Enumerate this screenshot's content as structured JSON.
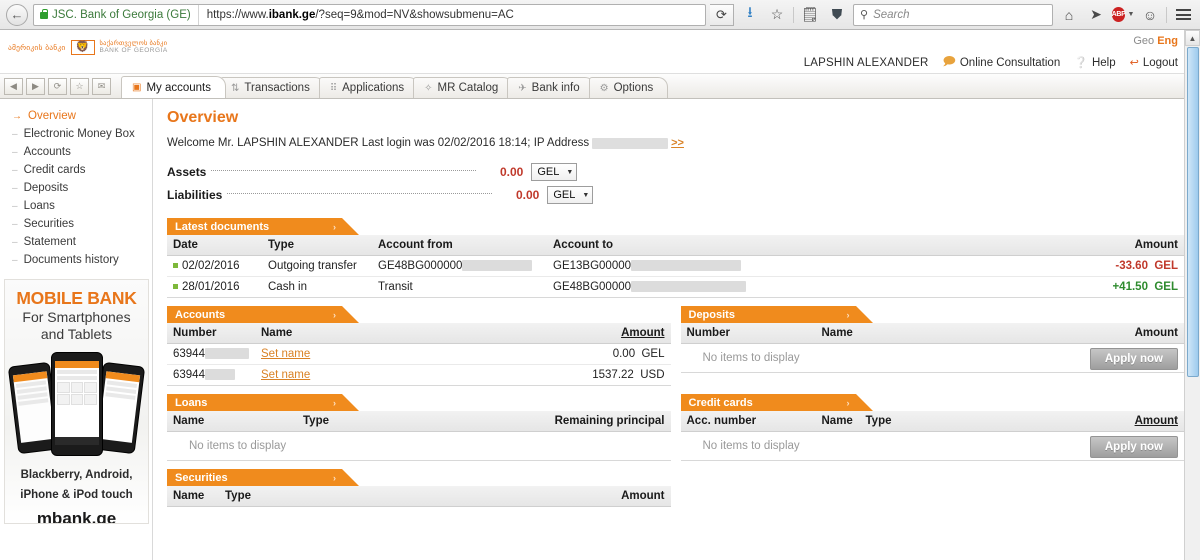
{
  "browser": {
    "back_label": "←",
    "site_identity": "JSC. Bank of Georgia (GE)",
    "url_prefix": "https://www.",
    "url_domain": "ibank.ge",
    "url_path": "/?seq=9&mod=NV&showsubmenu=AC",
    "reload_label": "⟳",
    "search_placeholder": "Search",
    "toolbar_icons": [
      "download-icon",
      "bookmark-star-icon",
      "reading-list-icon",
      "pocket-icon",
      "home-icon",
      "send-tab-icon",
      "adblock-icon",
      "smiley-icon",
      "menu-icon"
    ],
    "adblock_label": "ABP"
  },
  "header": {
    "lang_geo": "Geo",
    "lang_eng": "Eng",
    "logo_geo_text": "ამერიკის ბანკი",
    "logo_line1": "საქართველოს ბანკი",
    "logo_line2": "BANK OF GEORGIA",
    "user_name": "LAPSHIN ALEXANDER",
    "online_consultation": "Online Consultation",
    "help": "Help",
    "logout": "Logout"
  },
  "tabs": [
    {
      "label": "My accounts",
      "icon": "accounts-icon",
      "active": true
    },
    {
      "label": "Transactions",
      "icon": "transfer-icon",
      "active": false
    },
    {
      "label": "Applications",
      "icon": "grid-icon",
      "active": false
    },
    {
      "label": "MR Catalog",
      "icon": "star-icon",
      "active": false
    },
    {
      "label": "Bank info",
      "icon": "info-icon",
      "active": false
    },
    {
      "label": "Options",
      "icon": "gear-icon",
      "active": false
    }
  ],
  "mini_buttons": [
    "prev-arrow",
    "next-arrow",
    "refresh",
    "favorite",
    "mail"
  ],
  "sidebar": {
    "items": [
      {
        "label": "Overview",
        "active": true
      },
      {
        "label": "Electronic Money Box",
        "active": false
      },
      {
        "label": "Accounts",
        "active": false
      },
      {
        "label": "Credit cards",
        "active": false
      },
      {
        "label": "Deposits",
        "active": false
      },
      {
        "label": "Loans",
        "active": false
      },
      {
        "label": "Securities",
        "active": false
      },
      {
        "label": "Statement",
        "active": false
      },
      {
        "label": "Documents history",
        "active": false
      }
    ],
    "promo": {
      "title": "MOBILE BANK",
      "subtitle_line1": "For Smartphones",
      "subtitle_line2": "and Tablets",
      "platforms_line1": "Blackberry, Android,",
      "platforms_line2": "iPhone & iPod touch",
      "site": "mbank.ge"
    }
  },
  "main": {
    "page_title": "Overview",
    "welcome_text": "Welcome Mr. LAPSHIN ALEXANDER Last login was 02/02/2016 18:14; IP Address",
    "welcome_more": ">>",
    "totals": [
      {
        "label": "Assets",
        "value": "0.00",
        "currency": "GEL"
      },
      {
        "label": "Liabilities",
        "value": "0.00",
        "currency": "GEL"
      }
    ],
    "latest_documents": {
      "title": "Latest documents",
      "columns": [
        "Date",
        "Type",
        "Account from",
        "Account to",
        "Amount"
      ],
      "rows": [
        {
          "date": "02/02/2016",
          "type": "Outgoing transfer",
          "account_from": "GE48BG000000",
          "account_to": "GE13BG00000",
          "amount": "-33.60",
          "currency": "GEL",
          "sign": "negative"
        },
        {
          "date": "28/01/2016",
          "type": "Cash in",
          "account_from": "Transit",
          "account_to": "GE48BG00000",
          "amount": "+41.50",
          "currency": "GEL",
          "sign": "positive"
        }
      ]
    },
    "accounts": {
      "title": "Accounts",
      "columns": [
        "Number",
        "Name",
        "Amount"
      ],
      "rows": [
        {
          "number": "63944",
          "name": "Set name",
          "amount": "0.00",
          "currency": "GEL"
        },
        {
          "number": "63944",
          "name": "Set name",
          "amount": "1537.22",
          "currency": "USD"
        }
      ]
    },
    "deposits": {
      "title": "Deposits",
      "columns": [
        "Number",
        "Name",
        "Amount"
      ],
      "empty_text": "No items to display",
      "apply_label": "Apply now"
    },
    "loans": {
      "title": "Loans",
      "columns": [
        "Name",
        "Type",
        "Remaining principal"
      ],
      "empty_text": "No items to display"
    },
    "credit_cards": {
      "title": "Credit cards",
      "columns": [
        "Acc. number",
        "Name",
        "Type",
        "Amount"
      ],
      "empty_text": "No items to display",
      "apply_label": "Apply now"
    },
    "securities": {
      "title": "Securities",
      "columns": [
        "Name",
        "Type",
        "Amount"
      ]
    }
  },
  "colors": {
    "accent": "#f08b1d",
    "accent_text": "#e8761b",
    "negative": "#c0392b",
    "positive": "#2e8b2e"
  }
}
